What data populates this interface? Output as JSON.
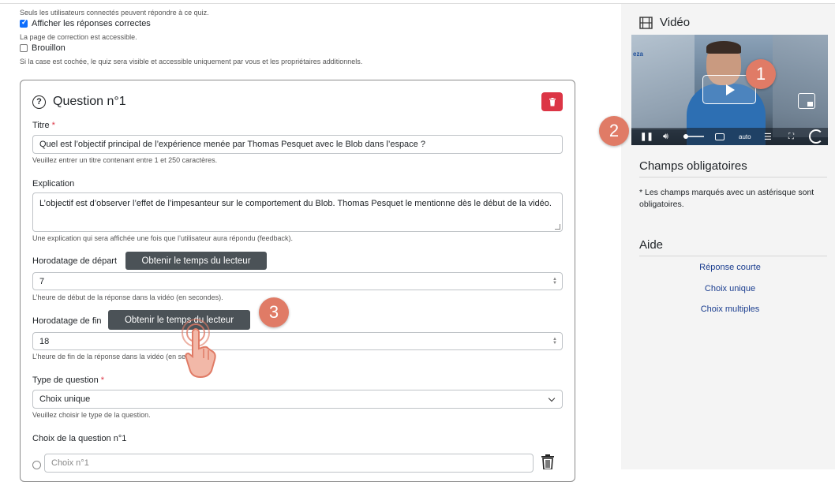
{
  "form": {
    "note_connected": "Seuls les utilisateurs connectés peuvent répondre à ce quiz.",
    "show_correct_label": "Afficher les réponses correctes",
    "show_correct_checked": true,
    "note_correction": "La page de correction est accessible.",
    "draft_label": "Brouillon",
    "draft_checked": false,
    "note_draft": "Si la case est cochée, le quiz sera visible et accessible uniquement par vous et les propriétaires additionnels."
  },
  "question": {
    "heading": "Question n°1",
    "title_label": "Titre",
    "title_value": "Quel est l’objectif principal de l’expérience menée par Thomas Pesquet avec le Blob dans l’espace ?",
    "title_help": "Veuillez entrer un titre contenant entre 1 et 250 caractères.",
    "explanation_label": "Explication",
    "explanation_value": "L’objectif est d’observer l’effet de l’impesanteur sur le comportement du Blob. Thomas Pesquet le mentionne dès le début de la vidéo.",
    "explanation_help": "Une explication qui sera affichée une fois que l’utilisateur aura répondu (feedback).",
    "start_label": "Horodatage de départ",
    "get_time_button": "Obtenir le temps du lecteur",
    "start_value": "7",
    "start_help": "L’heure de début de la réponse dans la vidéo (en secondes).",
    "end_label": "Horodatage de fin",
    "end_value": "18",
    "end_help": "L’heure de fin de la réponse dans la vidéo (en secondes).",
    "type_label": "Type de question",
    "type_value": "Choix unique",
    "type_help": "Veuillez choisir le type de la question.",
    "choices_label": "Choix de la question n°1",
    "choice1_placeholder": "Choix n°1",
    "required_mark": "*"
  },
  "sidebar": {
    "video_title": "Vidéo",
    "video_logo": "eza",
    "ctrl_auto": "auto",
    "required_title": "Champs obligatoires",
    "required_text": "* Les champs marqués avec un astérisque sont obligatoires.",
    "help_title": "Aide",
    "help_links": [
      "Réponse courte",
      "Choix unique",
      "Choix multiples"
    ]
  },
  "annotations": {
    "badge1": "1",
    "badge2": "2",
    "badge3": "3"
  },
  "colors": {
    "accent": "#0d6efd",
    "danger": "#dc3545",
    "badge": "#e07b66",
    "dark_button": "#4b5257",
    "link": "#1a3d8f"
  }
}
